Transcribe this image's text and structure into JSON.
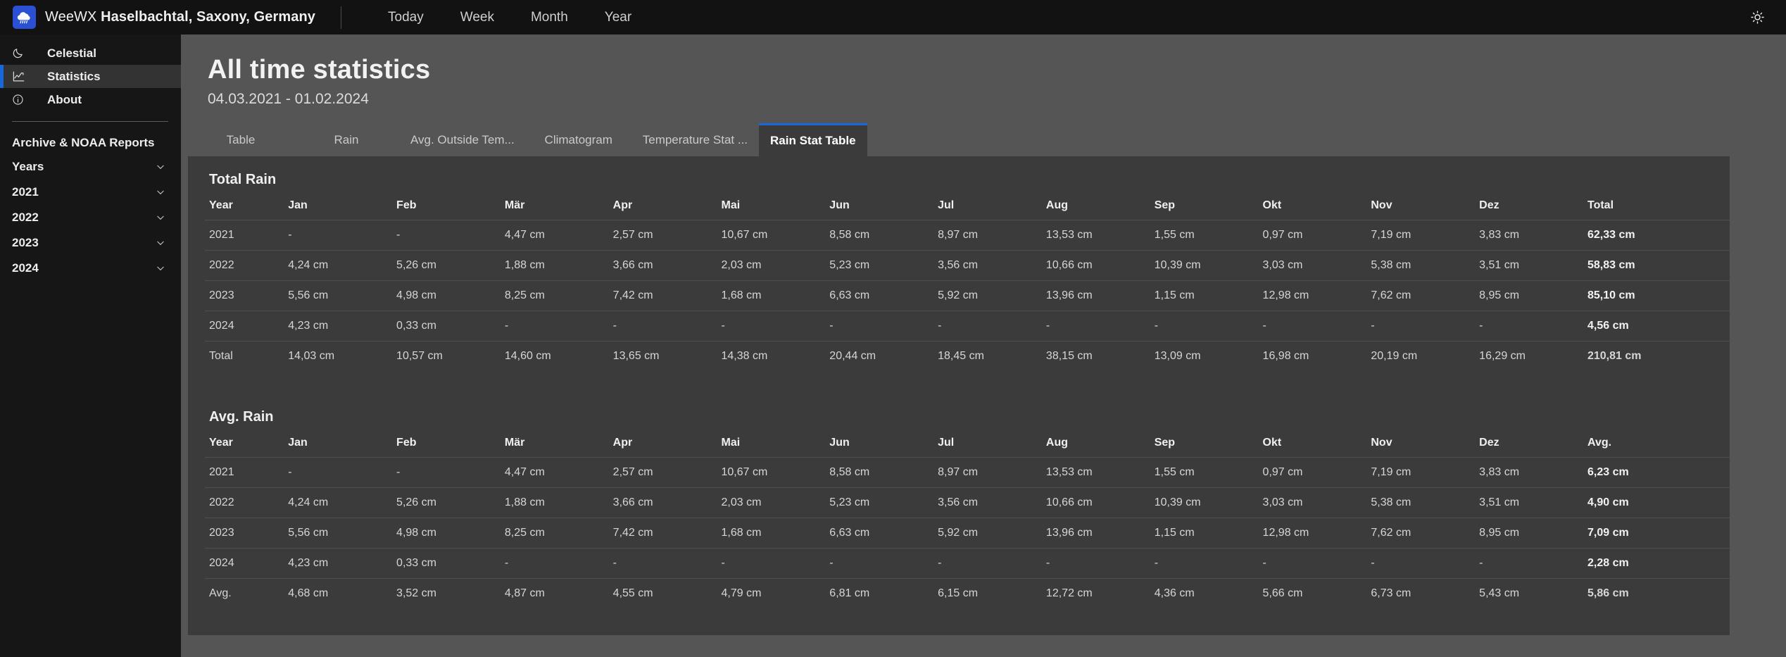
{
  "topbar": {
    "logo_icon": "weewx-cloud-rain-logo",
    "brand_prefix": "WeeWX ",
    "brand_location": "Haselbachtal, Saxony, Germany",
    "nav": [
      {
        "label": "Today"
      },
      {
        "label": "Week"
      },
      {
        "label": "Month"
      },
      {
        "label": "Year"
      }
    ],
    "theme_toggle_icon": "sun-icon"
  },
  "sidebar": {
    "items": [
      {
        "label": "Celestial",
        "icon": "moon-icon",
        "active": false
      },
      {
        "label": "Statistics",
        "icon": "chart-line-icon",
        "active": true
      },
      {
        "label": "About",
        "icon": "info-circle-icon",
        "active": false
      }
    ],
    "archive_title": "Archive & NOAA Reports",
    "collapsibles": [
      {
        "label": "Years",
        "icon": "chevron-down-icon"
      },
      {
        "label": "2021",
        "icon": "chevron-down-icon"
      },
      {
        "label": "2022",
        "icon": "chevron-down-icon"
      },
      {
        "label": "2023",
        "icon": "chevron-down-icon"
      },
      {
        "label": "2024",
        "icon": "chevron-down-icon"
      }
    ]
  },
  "page": {
    "title": "All time statistics",
    "subtitle": "04.03.2021 - 01.02.2024"
  },
  "tabs": [
    {
      "label": "Table",
      "active": false
    },
    {
      "label": "Rain",
      "active": false
    },
    {
      "label": "Avg. Outside Tem...",
      "active": false
    },
    {
      "label": "Climatogram",
      "active": false
    },
    {
      "label": "Temperature Stat ...",
      "active": false
    },
    {
      "label": "Rain Stat Table",
      "active": true
    }
  ],
  "tables": [
    {
      "title": "Total Rain",
      "columns": [
        "Year",
        "Jan",
        "Feb",
        "Mär",
        "Apr",
        "Mai",
        "Jun",
        "Jul",
        "Aug",
        "Sep",
        "Okt",
        "Nov",
        "Dez",
        "Total"
      ],
      "rows": [
        [
          "2021",
          "-",
          "-",
          "4,47 cm",
          "2,57 cm",
          "10,67 cm",
          "8,58 cm",
          "8,97 cm",
          "13,53 cm",
          "1,55 cm",
          "0,97 cm",
          "7,19 cm",
          "3,83 cm",
          "62,33 cm"
        ],
        [
          "2022",
          "4,24 cm",
          "5,26 cm",
          "1,88 cm",
          "3,66 cm",
          "2,03 cm",
          "5,23 cm",
          "3,56 cm",
          "10,66 cm",
          "10,39 cm",
          "3,03 cm",
          "5,38 cm",
          "3,51 cm",
          "58,83 cm"
        ],
        [
          "2023",
          "5,56 cm",
          "4,98 cm",
          "8,25 cm",
          "7,42 cm",
          "1,68 cm",
          "6,63 cm",
          "5,92 cm",
          "13,96 cm",
          "1,15 cm",
          "12,98 cm",
          "7,62 cm",
          "8,95 cm",
          "85,10 cm"
        ],
        [
          "2024",
          "4,23 cm",
          "0,33 cm",
          "-",
          "-",
          "-",
          "-",
          "-",
          "-",
          "-",
          "-",
          "-",
          "-",
          "4,56 cm"
        ],
        [
          "Total",
          "14,03 cm",
          "10,57 cm",
          "14,60 cm",
          "13,65 cm",
          "14,38 cm",
          "20,44 cm",
          "18,45 cm",
          "38,15 cm",
          "13,09 cm",
          "16,98 cm",
          "20,19 cm",
          "16,29 cm",
          "210,81 cm"
        ]
      ]
    },
    {
      "title": "Avg. Rain",
      "columns": [
        "Year",
        "Jan",
        "Feb",
        "Mär",
        "Apr",
        "Mai",
        "Jun",
        "Jul",
        "Aug",
        "Sep",
        "Okt",
        "Nov",
        "Dez",
        "Avg."
      ],
      "rows": [
        [
          "2021",
          "-",
          "-",
          "4,47 cm",
          "2,57 cm",
          "10,67 cm",
          "8,58 cm",
          "8,97 cm",
          "13,53 cm",
          "1,55 cm",
          "0,97 cm",
          "7,19 cm",
          "3,83 cm",
          "6,23 cm"
        ],
        [
          "2022",
          "4,24 cm",
          "5,26 cm",
          "1,88 cm",
          "3,66 cm",
          "2,03 cm",
          "5,23 cm",
          "3,56 cm",
          "10,66 cm",
          "10,39 cm",
          "3,03 cm",
          "5,38 cm",
          "3,51 cm",
          "4,90 cm"
        ],
        [
          "2023",
          "5,56 cm",
          "4,98 cm",
          "8,25 cm",
          "7,42 cm",
          "1,68 cm",
          "6,63 cm",
          "5,92 cm",
          "13,96 cm",
          "1,15 cm",
          "12,98 cm",
          "7,62 cm",
          "8,95 cm",
          "7,09 cm"
        ],
        [
          "2024",
          "4,23 cm",
          "0,33 cm",
          "-",
          "-",
          "-",
          "-",
          "-",
          "-",
          "-",
          "-",
          "-",
          "-",
          "2,28 cm"
        ],
        [
          "Avg.",
          "4,68 cm",
          "3,52 cm",
          "4,87 cm",
          "4,55 cm",
          "4,79 cm",
          "6,81 cm",
          "6,15 cm",
          "12,72 cm",
          "4,36 cm",
          "5,66 cm",
          "6,73 cm",
          "5,43 cm",
          "5,86 cm"
        ]
      ]
    }
  ],
  "colors": {
    "accent": "#1668dc",
    "brand_blue": "#2b50d4",
    "topbar_bg": "#121212",
    "sidebar_bg": "#161616",
    "main_bg": "#555555",
    "card_bg": "#3b3b3b"
  }
}
